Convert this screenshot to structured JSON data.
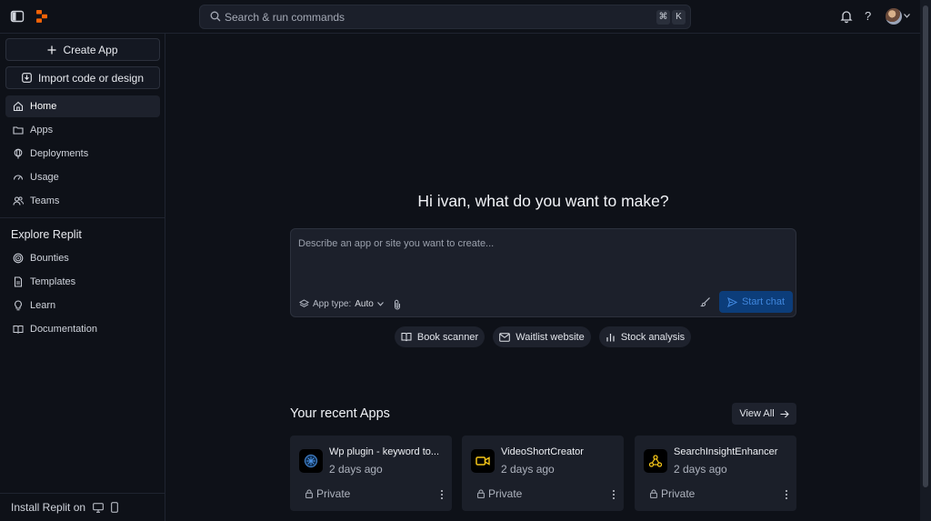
{
  "topbar": {
    "search_placeholder": "Search & run commands",
    "shortcut_keys": [
      "⌘",
      "K"
    ],
    "help_label": "?"
  },
  "sidebar": {
    "create_app": "Create App",
    "import": "Import code or design",
    "nav": [
      {
        "label": "Home",
        "icon": "home-icon",
        "active": true
      },
      {
        "label": "Apps",
        "icon": "folder-icon"
      },
      {
        "label": "Deployments",
        "icon": "globe-pin-icon"
      },
      {
        "label": "Usage",
        "icon": "gauge-icon"
      },
      {
        "label": "Teams",
        "icon": "users-icon"
      }
    ],
    "explore_heading": "Explore Replit",
    "explore": [
      {
        "label": "Bounties",
        "icon": "target-icon"
      },
      {
        "label": "Templates",
        "icon": "template-icon"
      },
      {
        "label": "Learn",
        "icon": "lightbulb-icon"
      },
      {
        "label": "Documentation",
        "icon": "book-icon"
      }
    ],
    "install_label": "Install Replit on"
  },
  "main": {
    "greeting": "Hi ivan, what do you want to make?",
    "prompt_placeholder": "Describe an app or site you want to create...",
    "app_type_label": "App type:",
    "app_type_value": "Auto",
    "start_chat": "Start chat",
    "suggestions": [
      {
        "label": "Book scanner",
        "icon": "book-open-icon"
      },
      {
        "label": "Waitlist website",
        "icon": "mail-icon"
      },
      {
        "label": "Stock analysis",
        "icon": "bar-chart-icon"
      }
    ],
    "recent_title": "Your recent Apps",
    "view_all": "View All",
    "recent_apps": [
      {
        "name": "Wp plugin - keyword to...",
        "time": "2 days ago",
        "visibility": "Private",
        "icon": "network-icon",
        "icon_color": "#4a90e2"
      },
      {
        "name": "VideoShortCreator",
        "time": "2 days ago",
        "visibility": "Private",
        "icon": "video-icon",
        "icon_color": "#f5c518"
      },
      {
        "name": "SearchInsightEnhancer",
        "time": "2 days ago",
        "visibility": "Private",
        "icon": "webhook-icon",
        "icon_color": "#f5c518"
      }
    ]
  },
  "colors": {
    "accent": "#f26207",
    "start_chat_bg": "#0c3d7a",
    "start_chat_text": "#3f86dd"
  }
}
